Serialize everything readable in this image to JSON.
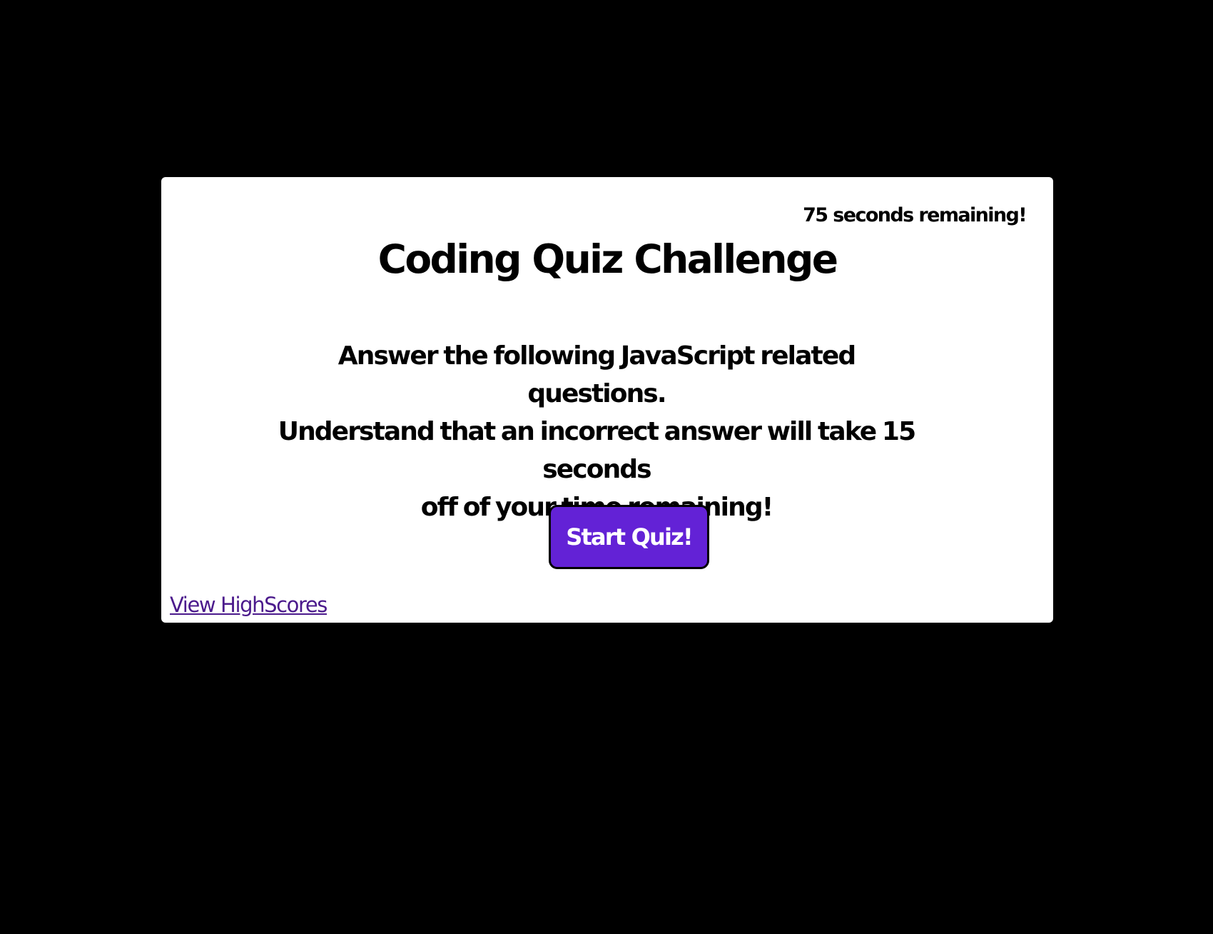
{
  "quiz": {
    "timer_text": "75 seconds remaining!",
    "title": "Coding Quiz Challenge",
    "instructions_line1": "Answer the following JavaScript related questions.",
    "instructions_line2": "Understand that an incorrect answer will take 15 seconds",
    "instructions_line3": "off of your time remaining!",
    "start_label": "Start Quiz!",
    "highscores_label": "View HighScores"
  },
  "colors": {
    "background": "#000000",
    "card": "#ffffff",
    "button": "#6322d6",
    "link": "#4b1a8c"
  }
}
